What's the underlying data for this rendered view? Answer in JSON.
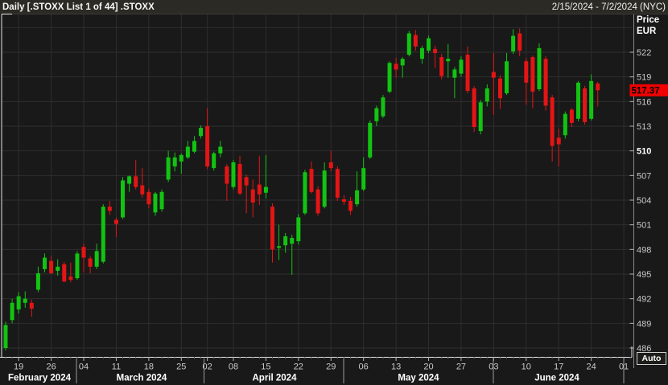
{
  "header": {
    "title": "Daily [.STOXX List 1 of 44] .STOXX",
    "date_range": "2/15/2024 - 7/2/2024 (NYC)"
  },
  "price_axis": {
    "title_line1": "Price",
    "title_line2": "EUR",
    "labeled_ticks": [
      522,
      519,
      516,
      513,
      510,
      507,
      504,
      501,
      498,
      495,
      492,
      489,
      486
    ],
    "emphasized_tick": 510,
    "last_price_label": "517.37"
  },
  "controls": {
    "auto_label": "Auto"
  },
  "colors": {
    "up": "#12c312",
    "down": "#e31515",
    "badge_bg": "#f00000",
    "badge_text": "#000000",
    "grid": "#2e2e2e",
    "plot_bg": "#191919",
    "header_bg": "#2b2a24",
    "axis_text": "#c9c9c9",
    "axis_text_bold": "#ffffff",
    "frame": "#e8e8e8",
    "axis_line": "#8a8a8a"
  },
  "chart_data": {
    "type": "candlestick",
    "title": "Daily [.STOXX List 1 of 44] .STOXX",
    "currency": "EUR",
    "period": "Daily",
    "range": "2/15/2024 - 7/2/2024 (NYC)",
    "last_price": 517.37,
    "y_axis": {
      "min": 484.7,
      "max": 526.3,
      "tick_step": 3,
      "first_gridline": 486,
      "last_gridline": 525
    },
    "x_ticks": [
      {
        "label": "19",
        "i": 2
      },
      {
        "label": "26",
        "i": 7
      },
      {
        "label": "04",
        "i": 12
      },
      {
        "label": "11",
        "i": 17
      },
      {
        "label": "18",
        "i": 22
      },
      {
        "label": "25",
        "i": 27
      },
      {
        "label": "02",
        "i": 31
      },
      {
        "label": "08",
        "i": 35
      },
      {
        "label": "15",
        "i": 40
      },
      {
        "label": "22",
        "i": 45
      },
      {
        "label": "29",
        "i": 50
      },
      {
        "label": "06",
        "i": 55
      },
      {
        "label": "13",
        "i": 60
      },
      {
        "label": "20",
        "i": 65
      },
      {
        "label": "27",
        "i": 70
      },
      {
        "label": "03",
        "i": 75
      },
      {
        "label": "10",
        "i": 80
      },
      {
        "label": "17",
        "i": 85
      },
      {
        "label": "24",
        "i": 90
      },
      {
        "label": "01",
        "i": 95
      }
    ],
    "months": [
      "February 2024",
      "March 2024",
      "April 2024",
      "May 2024",
      "June 2024"
    ],
    "candle_columns": [
      "date",
      "open",
      "high",
      "low",
      "close"
    ],
    "candles": [
      [
        "2024-02-15",
        486.0,
        489.2,
        485.7,
        488.8
      ],
      [
        "2024-02-16",
        489.4,
        492.0,
        489.0,
        491.5
      ],
      [
        "2024-02-19",
        490.7,
        492.8,
        490.2,
        492.3
      ],
      [
        "2024-02-20",
        491.5,
        492.9,
        490.9,
        492.0
      ],
      [
        "2024-02-21",
        491.5,
        491.9,
        489.8,
        490.8
      ],
      [
        "2024-02-22",
        493.1,
        495.9,
        492.8,
        495.1
      ],
      [
        "2024-02-23",
        495.6,
        497.5,
        495.2,
        497.0
      ],
      [
        "2024-02-26",
        496.6,
        497.2,
        495.0,
        495.1
      ],
      [
        "2024-02-27",
        495.4,
        496.8,
        494.8,
        495.9
      ],
      [
        "2024-02-28",
        496.2,
        496.5,
        494.0,
        494.1
      ],
      [
        "2024-02-29",
        494.7,
        496.4,
        494.0,
        494.3
      ],
      [
        "2024-03-01",
        494.5,
        497.8,
        494.3,
        497.5
      ],
      [
        "2024-03-04",
        498.3,
        498.7,
        495.2,
        497.0
      ],
      [
        "2024-03-05",
        496.9,
        497.2,
        495.1,
        495.9
      ],
      [
        "2024-03-06",
        495.9,
        498.7,
        495.6,
        497.8
      ],
      [
        "2024-03-07",
        496.5,
        503.5,
        496.3,
        503.2
      ],
      [
        "2024-03-08",
        503.2,
        503.9,
        502.2,
        502.7
      ],
      [
        "2024-03-11",
        501.6,
        501.9,
        499.5,
        501.1
      ],
      [
        "2024-03-12",
        501.9,
        506.8,
        501.7,
        506.4
      ],
      [
        "2024-03-13",
        506.0,
        507.0,
        505.0,
        506.9
      ],
      [
        "2024-03-14",
        506.9,
        508.9,
        505.3,
        505.6
      ],
      [
        "2024-03-15",
        505.8,
        507.9,
        504.3,
        504.7
      ],
      [
        "2024-03-18",
        505.0,
        505.4,
        503.0,
        503.5
      ],
      [
        "2024-03-19",
        502.5,
        505.0,
        502.1,
        504.8
      ],
      [
        "2024-03-20",
        502.9,
        505.3,
        502.6,
        505.0
      ],
      [
        "2024-03-21",
        506.5,
        510.0,
        506.2,
        509.2
      ],
      [
        "2024-03-22",
        508.1,
        509.8,
        507.5,
        509.2
      ],
      [
        "2024-03-25",
        508.7,
        509.7,
        507.2,
        509.5
      ],
      [
        "2024-03-26",
        509.2,
        511.2,
        509.0,
        510.5
      ],
      [
        "2024-03-27",
        509.9,
        511.8,
        509.7,
        511.2
      ],
      [
        "2024-03-28",
        511.8,
        513.1,
        511.5,
        512.8
      ],
      [
        "2024-04-02",
        513.0,
        515.2,
        507.8,
        508.1
      ],
      [
        "2024-04-03",
        507.9,
        509.9,
        507.6,
        509.7
      ],
      [
        "2024-04-04",
        509.7,
        511.2,
        509.2,
        510.5
      ],
      [
        "2024-04-05",
        508.1,
        508.4,
        503.9,
        506.0
      ],
      [
        "2024-04-08",
        505.6,
        508.9,
        505.3,
        508.6
      ],
      [
        "2024-04-09",
        508.4,
        509.4,
        504.6,
        504.8
      ],
      [
        "2024-04-10",
        506.8,
        507.1,
        502.4,
        505.8
      ],
      [
        "2024-04-11",
        505.3,
        506.5,
        501.9,
        503.7
      ],
      [
        "2024-04-12",
        505.9,
        509.4,
        503.4,
        504.7
      ],
      [
        "2024-04-15",
        504.9,
        509.5,
        504.2,
        505.6
      ],
      [
        "2024-04-16",
        503.2,
        503.6,
        496.4,
        498.0
      ],
      [
        "2024-04-17",
        498.2,
        501.0,
        496.7,
        498.4
      ],
      [
        "2024-04-18",
        498.5,
        500.0,
        497.6,
        499.6
      ],
      [
        "2024-04-19",
        498.7,
        499.8,
        494.9,
        499.4
      ],
      [
        "2024-04-22",
        499.0,
        502.3,
        498.6,
        501.9
      ],
      [
        "2024-04-23",
        502.4,
        507.7,
        502.2,
        507.4
      ],
      [
        "2024-04-24",
        507.8,
        508.7,
        504.8,
        505.0
      ],
      [
        "2024-04-25",
        505.3,
        505.7,
        502.1,
        502.4
      ],
      [
        "2024-04-26",
        503.2,
        508.6,
        503.0,
        507.6
      ],
      [
        "2024-04-29",
        508.6,
        510.0,
        507.5,
        507.9
      ],
      [
        "2024-04-30",
        507.8,
        508.1,
        503.9,
        504.3
      ],
      [
        "2024-05-01",
        504.1,
        504.6,
        503.4,
        503.8
      ],
      [
        "2024-05-02",
        503.9,
        504.4,
        502.2,
        502.7
      ],
      [
        "2024-05-03",
        503.5,
        507.5,
        503.2,
        505.2
      ],
      [
        "2024-05-06",
        505.3,
        509.2,
        505.1,
        507.9
      ],
      [
        "2024-05-07",
        509.2,
        513.7,
        509.0,
        513.4
      ],
      [
        "2024-05-08",
        513.6,
        515.5,
        513.0,
        515.2
      ],
      [
        "2024-05-09",
        514.2,
        516.8,
        514.0,
        516.5
      ],
      [
        "2024-05-10",
        517.2,
        520.9,
        517.0,
        520.7
      ],
      [
        "2024-05-13",
        520.6,
        521.3,
        518.9,
        519.9
      ],
      [
        "2024-05-14",
        520.4,
        521.4,
        518.9,
        521.2
      ],
      [
        "2024-05-15",
        521.7,
        524.6,
        521.5,
        524.3
      ],
      [
        "2024-05-16",
        524.1,
        524.7,
        522.2,
        522.7
      ],
      [
        "2024-05-17",
        521.2,
        522.8,
        520.6,
        522.5
      ],
      [
        "2024-05-20",
        522.2,
        524.0,
        521.9,
        523.7
      ],
      [
        "2024-05-21",
        522.4,
        522.8,
        520.1,
        521.9
      ],
      [
        "2024-05-22",
        521.4,
        521.8,
        518.7,
        519.1
      ],
      [
        "2024-05-23",
        520.9,
        523.0,
        518.9,
        521.2
      ],
      [
        "2024-05-24",
        518.9,
        520.2,
        516.4,
        519.9
      ],
      [
        "2024-05-27",
        519.4,
        521.5,
        519.0,
        521.1
      ],
      [
        "2024-05-28",
        521.7,
        522.7,
        517.0,
        517.3
      ],
      [
        "2024-05-29",
        517.6,
        517.9,
        512.3,
        512.9
      ],
      [
        "2024-05-30",
        512.4,
        516.2,
        512.0,
        515.9
      ],
      [
        "2024-05-31",
        516.0,
        518.1,
        515.4,
        517.6
      ],
      [
        "2024-06-03",
        519.6,
        521.9,
        514.4,
        518.9
      ],
      [
        "2024-06-04",
        518.8,
        519.2,
        515.1,
        516.4
      ],
      [
        "2024-06-05",
        517.0,
        521.9,
        516.8,
        520.9
      ],
      [
        "2024-06-06",
        522.1,
        524.8,
        521.8,
        524.0
      ],
      [
        "2024-06-07",
        524.3,
        524.9,
        521.5,
        522.2
      ],
      [
        "2024-06-10",
        520.9,
        521.3,
        515.6,
        518.3
      ],
      [
        "2024-06-11",
        521.4,
        521.6,
        515.2,
        517.2
      ],
      [
        "2024-06-12",
        517.5,
        523.1,
        517.3,
        522.5
      ],
      [
        "2024-06-13",
        521.2,
        521.5,
        514.9,
        515.5
      ],
      [
        "2024-06-14",
        516.5,
        516.8,
        508.7,
        510.6
      ],
      [
        "2024-06-17",
        511.6,
        512.7,
        508.1,
        510.8
      ],
      [
        "2024-06-18",
        511.9,
        514.8,
        511.5,
        514.5
      ],
      [
        "2024-06-19",
        515.0,
        515.2,
        512.9,
        513.4
      ],
      [
        "2024-06-20",
        513.9,
        518.5,
        513.6,
        518.3
      ],
      [
        "2024-06-21",
        517.6,
        517.9,
        513.2,
        513.5
      ],
      [
        "2024-06-24",
        513.9,
        519.3,
        513.7,
        518.5
      ],
      [
        "2024-06-25",
        518.2,
        518.4,
        515.4,
        517.37
      ]
    ]
  }
}
